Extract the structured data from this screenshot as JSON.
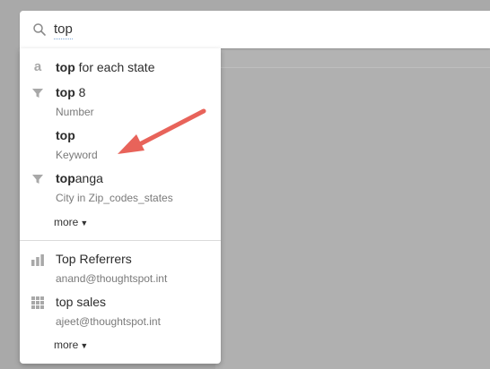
{
  "search": {
    "query": "top"
  },
  "suggestions": [
    {
      "bold": "top",
      "rest": " for each state",
      "sub": "",
      "icon": "answer-a-icon"
    },
    {
      "bold": "top",
      "rest": " 8",
      "sub": "Number",
      "icon": "filter-icon"
    },
    {
      "bold": "top",
      "rest": "",
      "sub": "Keyword",
      "icon": ""
    },
    {
      "bold": "top",
      "rest": "anga",
      "sub": "City in Zip_codes_states",
      "icon": "filter-icon"
    }
  ],
  "more_label": "more",
  "saved": [
    {
      "title": "Top Referrers",
      "sub": "anand@thoughtspot.int",
      "icon": "bar-chart-icon"
    },
    {
      "title": "top sales",
      "sub": "ajeet@thoughtspot.int",
      "icon": "table-grid-icon"
    }
  ],
  "more_label_2": "more",
  "colors": {
    "arrow": "#e8635a",
    "background": "#a9a9a9",
    "icon": "#a8a8a8"
  }
}
